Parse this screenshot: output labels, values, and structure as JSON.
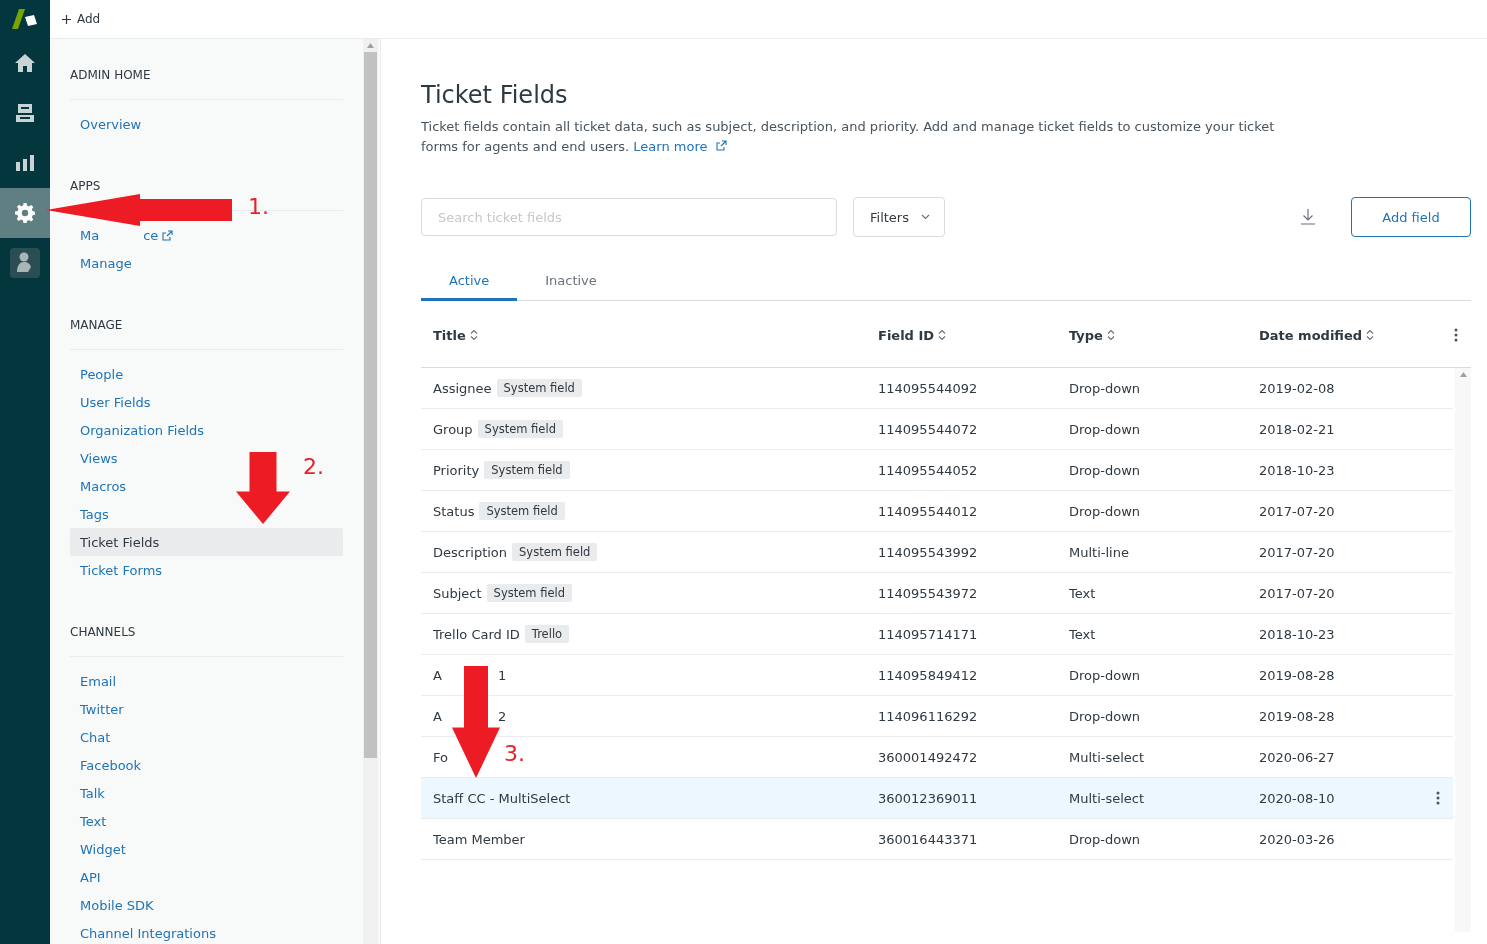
{
  "rail": [
    {
      "kind": "logo",
      "selected": false
    },
    {
      "kind": "home",
      "selected": false
    },
    {
      "kind": "views",
      "selected": false
    },
    {
      "kind": "reporting",
      "selected": false
    },
    {
      "kind": "admin",
      "selected": true
    },
    {
      "kind": "person",
      "selected": false
    }
  ],
  "topbar": {
    "add_label": "Add"
  },
  "sidebar": {
    "sections": [
      {
        "heading": "ADMIN HOME",
        "items": [
          {
            "label": "Overview",
            "selected": false
          }
        ]
      },
      {
        "heading": "APPS",
        "items": [
          {
            "label": "Ma",
            "label_end": "ce",
            "external": true,
            "selected": false
          },
          {
            "label": "Manage",
            "selected": false
          }
        ]
      },
      {
        "heading": "MANAGE",
        "items": [
          {
            "label": "People",
            "selected": false
          },
          {
            "label": "User Fields",
            "selected": false
          },
          {
            "label": "Organization Fields",
            "selected": false
          },
          {
            "label": "Views",
            "selected": false
          },
          {
            "label": "Macros",
            "selected": false
          },
          {
            "label": "Tags",
            "selected": false
          },
          {
            "label": "Ticket Fields",
            "selected": true
          },
          {
            "label": "Ticket Forms",
            "selected": false
          }
        ]
      },
      {
        "heading": "CHANNELS",
        "items": [
          {
            "label": "Email",
            "selected": false
          },
          {
            "label": "Twitter",
            "selected": false
          },
          {
            "label": "Chat",
            "selected": false
          },
          {
            "label": "Facebook",
            "selected": false
          },
          {
            "label": "Talk",
            "selected": false
          },
          {
            "label": "Text",
            "selected": false
          },
          {
            "label": "Widget",
            "selected": false
          },
          {
            "label": "API",
            "selected": false
          },
          {
            "label": "Mobile SDK",
            "selected": false
          },
          {
            "label": "Channel Integrations",
            "selected": false
          }
        ]
      }
    ]
  },
  "page": {
    "title": "Ticket Fields",
    "description": "Ticket fields contain all ticket data, such as subject, description, and priority. Add and manage ticket fields to customize your ticket forms for agents and end users.",
    "learn_more": "Learn more"
  },
  "toolbar": {
    "search": {
      "placeholder": "Search ticket fields"
    },
    "filters": "Filters",
    "add_button": "Add field"
  },
  "tabs": [
    {
      "label": "Active",
      "selected": true
    },
    {
      "label": "Inactive",
      "selected": false
    }
  ],
  "table": {
    "columns": [
      "Title",
      "Field ID",
      "Type",
      "Date modified"
    ],
    "rows": [
      {
        "title": "Assignee",
        "badge": "System field",
        "field_id": "114095544092",
        "type": "Drop-down",
        "date": "2019-02-08",
        "selected": false
      },
      {
        "title": "Group",
        "badge": "System field",
        "field_id": "114095544072",
        "type": "Drop-down",
        "date": "2018-02-21",
        "selected": false
      },
      {
        "title": "Priority",
        "badge": "System field",
        "field_id": "114095544052",
        "type": "Drop-down",
        "date": "2018-10-23",
        "selected": false
      },
      {
        "title": "Status",
        "badge": "System field",
        "field_id": "114095544012",
        "type": "Drop-down",
        "date": "2017-07-20",
        "selected": false
      },
      {
        "title": "Description",
        "badge": "System field",
        "field_id": "114095543992",
        "type": "Multi-line",
        "date": "2017-07-20",
        "selected": false
      },
      {
        "title": "Subject",
        "badge": "System field",
        "field_id": "114095543972",
        "type": "Text",
        "date": "2017-07-20",
        "selected": false
      },
      {
        "title": "Trello Card ID",
        "badge": "Trello",
        "field_id": "114095714171",
        "type": "Text",
        "date": "2018-10-23",
        "selected": false
      },
      {
        "title": "A",
        "title_end": "1",
        "field_id": "114095849412",
        "type": "Drop-down",
        "date": "2019-08-28",
        "selected": false
      },
      {
        "title": "A",
        "title_end": "2",
        "field_id": "114096116292",
        "type": "Drop-down",
        "date": "2019-08-28",
        "selected": false
      },
      {
        "title": "Fo",
        "field_id": "360001492472",
        "type": "Multi-select",
        "date": "2020-06-27",
        "selected": false
      },
      {
        "title": "Staff CC - MultiSelect",
        "field_id": "360012369011",
        "type": "Multi-select",
        "date": "2020-08-10",
        "selected": true
      },
      {
        "title": "Team Member",
        "field_id": "360016443371",
        "type": "Drop-down",
        "date": "2020-03-26",
        "selected": false
      }
    ]
  },
  "annotations": [
    {
      "label": "1.",
      "kind": "left"
    },
    {
      "label": "2.",
      "kind": "down"
    },
    {
      "label": "3.",
      "kind": "down"
    }
  ]
}
